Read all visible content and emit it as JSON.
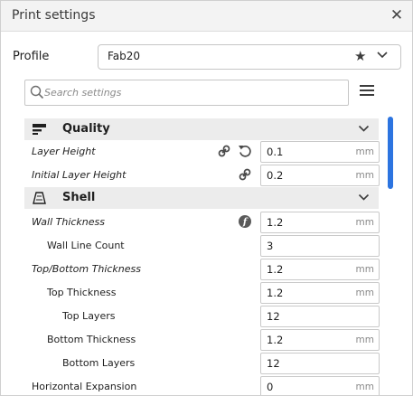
{
  "window": {
    "title": "Print settings"
  },
  "profile": {
    "label": "Profile",
    "value": "Fab20"
  },
  "search": {
    "placeholder": "Search settings"
  },
  "categories": [
    {
      "label": "Quality",
      "icon": "quality-icon"
    },
    {
      "label": "Shell",
      "icon": "shell-icon"
    }
  ],
  "settings": [
    {
      "label": "Layer Height",
      "value": "0.1",
      "unit": "mm"
    },
    {
      "label": "Initial Layer Height",
      "value": "0.2",
      "unit": "mm"
    },
    {
      "label": "Wall Thickness",
      "value": "1.2",
      "unit": "mm"
    },
    {
      "label": "Wall Line Count",
      "value": "3",
      "unit": ""
    },
    {
      "label": "Top/Bottom Thickness",
      "value": "1.2",
      "unit": "mm"
    },
    {
      "label": "Top Thickness",
      "value": "1.2",
      "unit": "mm"
    },
    {
      "label": "Top Layers",
      "value": "12",
      "unit": ""
    },
    {
      "label": "Bottom Thickness",
      "value": "1.2",
      "unit": "mm"
    },
    {
      "label": "Bottom Layers",
      "value": "12",
      "unit": ""
    },
    {
      "label": "Horizontal Expansion",
      "value": "0",
      "unit": "mm"
    }
  ],
  "colors": {
    "accent": "#2c74e0",
    "category_bg": "#ececec"
  }
}
